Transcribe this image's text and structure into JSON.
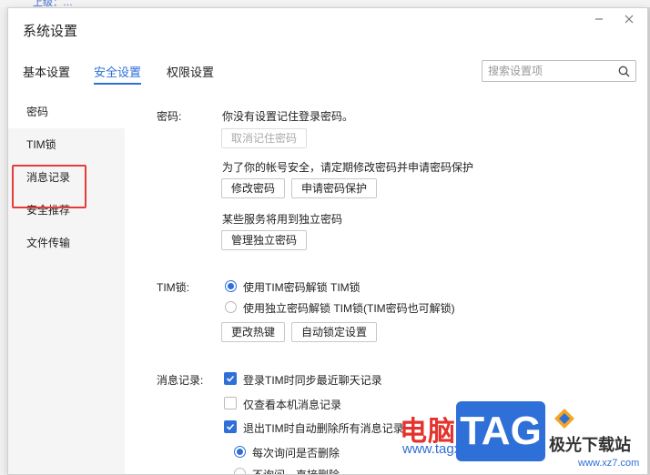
{
  "window": {
    "title": "系统设置",
    "behind_text": "上级：…"
  },
  "tabs": [
    {
      "label": "基本设置",
      "active": false
    },
    {
      "label": "安全设置",
      "active": true
    },
    {
      "label": "权限设置",
      "active": false
    }
  ],
  "search": {
    "placeholder": "搜索设置项",
    "icon": "search-icon"
  },
  "sidebar": {
    "items": [
      {
        "label": "密码",
        "selected": true
      },
      {
        "label": "TIM锁",
        "selected": false
      },
      {
        "label": "消息记录",
        "selected": false,
        "highlighted": true
      },
      {
        "label": "安全推荐",
        "selected": false
      },
      {
        "label": "文件传输",
        "selected": false
      }
    ]
  },
  "password": {
    "label": "密码:",
    "status_text": "你没有设置记住登录密码。",
    "cancel_remember_button": "取消记住密码",
    "security_tip": "为了你的帐号安全，请定期修改密码并申请密码保护",
    "change_password_button": "修改密码",
    "apply_protection_button": "申请密码保护",
    "independent_tip": "某些服务将用到独立密码",
    "manage_independent_button": "管理独立密码"
  },
  "tim_lock": {
    "label": "TIM锁:",
    "options": [
      {
        "label": "使用TIM密码解锁 TIM锁",
        "checked": true
      },
      {
        "label": "使用独立密码解锁 TIM锁(TIM密码也可解锁)",
        "checked": false
      }
    ],
    "change_hotkey_button": "更改热键",
    "auto_lock_button": "自动锁定设置"
  },
  "message_record": {
    "label": "消息记录:",
    "options": [
      {
        "label": "登录TIM时同步最近聊天记录",
        "checked": true
      },
      {
        "label": "仅查看本机消息记录",
        "checked": false
      },
      {
        "label": "退出TIM时自动删除所有消息记录",
        "checked": true
      }
    ],
    "sub_options": [
      {
        "label": "每次询问是否删除",
        "checked": true
      },
      {
        "label": "不询问，直接删除",
        "checked": false
      }
    ]
  },
  "watermark": {
    "cn_text": "电脑技术网",
    "url": "www.tagxp.com",
    "tag_text": "TAG",
    "site_text": "极光下载站",
    "site_url": "www.xz7.com"
  },
  "colors": {
    "accent": "#2e6fd8",
    "highlight_border": "#e63b3b"
  }
}
